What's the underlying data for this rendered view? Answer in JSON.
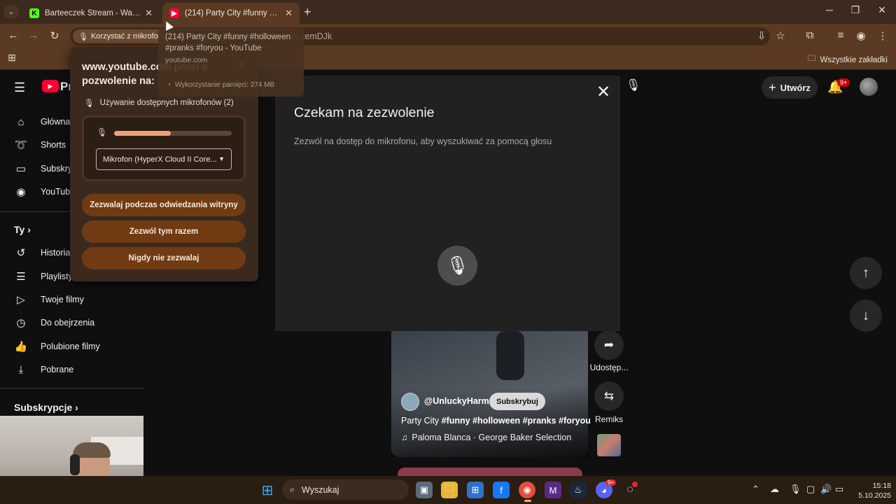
{
  "browser": {
    "tabs": [
      {
        "title": "Barteeczek Stream - Watch Live",
        "favicon": "kick-icon",
        "active": false
      },
      {
        "title": "(214) Party City #funny #hollow",
        "favicon": "youtube-icon",
        "active": true
      }
    ],
    "new_tab": "+",
    "window_controls": {
      "minimize": "─",
      "maximize": "❐",
      "close": "✕"
    },
    "mic_chip": "Korzystać z mikrofonu",
    "url": "(214) Party City #funny #hollo... ZbzemDJk",
    "bookmarks_all": "Wszystkie zakładki",
    "tab_hover": {
      "title": "(214) Party City #funny #holloween #pranks #foryou - YouTube",
      "domain": "youtube.com",
      "memory": "Wykorzystanie pamięci: 274 MB"
    }
  },
  "youtube": {
    "logo": "Pr",
    "sidebar": [
      {
        "label": "Główna",
        "icon": "home-icon"
      },
      {
        "label": "Shorts",
        "icon": "shorts-icon"
      },
      {
        "label": "Subskry",
        "icon": "subscriptions-icon"
      },
      {
        "label": "YouTube",
        "icon": "youtube-music-icon"
      }
    ],
    "you_section": "Ty",
    "you_items": [
      {
        "label": "Historia",
        "icon": "history-icon"
      },
      {
        "label": "Playlisty",
        "icon": "playlists-icon"
      },
      {
        "label": "Twoje filmy",
        "icon": "your-videos-icon"
      },
      {
        "label": "Do obejrzenia",
        "icon": "watch-later-icon"
      },
      {
        "label": "Polubione filmy",
        "icon": "liked-icon"
      },
      {
        "label": "Pobrane",
        "icon": "download-icon"
      }
    ],
    "subs_section": "Subskrypcje",
    "header": {
      "create": "Utwórz",
      "notif_badge": "9+"
    },
    "voice_dialog": {
      "title": "Czekam na zezwolenie",
      "subtitle": "Zezwól na dostęp do mikrofonu, aby wyszukiwać za pomocą głosu"
    },
    "short": {
      "channel": "@UnluckyHarmz",
      "subscribe": "Subskrybuj",
      "title_plain": "Party City ",
      "title_tags": "#funny #holloween #pranks #foryou",
      "music": "Paloma Blanca · George Baker Selection",
      "share_label": "Udostęp...",
      "remix_label": "Remiks"
    }
  },
  "permission_popup": {
    "title": "www.youtube.com prosi o pozwolenie na:",
    "mic_line": "Używanie dostępnych mikrofonów (2)",
    "mic_level": 0.48,
    "mic_select": "Mikrofon (HyperX Cloud II Core...",
    "buttons": [
      "Zezwalaj podczas odwiedzania witryny",
      "Zezwól tym razem",
      "Nigdy nie zezwalaj"
    ]
  },
  "taskbar": {
    "search": "Wyszukaj",
    "discord_badge": "9+",
    "time": "15:18",
    "date": "5.10.2025"
  },
  "colors": {
    "accent": "#703a12",
    "chrome": "#5a3a22",
    "page_bg": "#0f0f0f"
  }
}
